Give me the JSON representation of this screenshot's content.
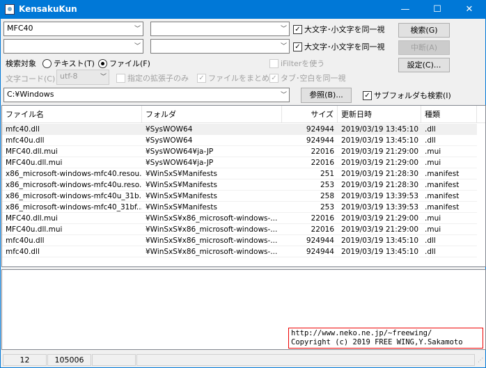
{
  "window": {
    "title": "KensakuKun",
    "minimize": "—",
    "maximize": "☐",
    "close": "✕"
  },
  "search": {
    "pattern1": "MFC40",
    "pattern2": "",
    "pattern3": "",
    "pattern4": "",
    "ignore_case_1": "大文字･小文字を同一視",
    "ignore_case_1_checked": true,
    "ignore_case_2": "大文字･小文字を同一視",
    "ignore_case_2_checked": true,
    "search_button": "検索(G)",
    "abort_button": "中断(A)",
    "settings_button": "設定(C)...",
    "target_label": "検索対象",
    "radio_text": "テキスト(T)",
    "radio_file": "ファイル(F)",
    "selected_target": "file",
    "ifilter": "iFilterを使う",
    "encoding_label": "文字コード(C)",
    "encoding_value": "utf-8",
    "ext_only": "指定の拡張子のみ",
    "group_files": "ファイルをまとめる",
    "tab_space": "タブ･空白を同一視",
    "path": "C:¥Windows",
    "browse_button": "参照(B)...",
    "subfolders": "サブフォルダも検索(I)",
    "subfolders_checked": true
  },
  "results": {
    "columns": [
      "ファイル名",
      "フォルダ",
      "サイズ",
      "更新日時",
      "種類"
    ],
    "rows": [
      [
        "mfc40.dll",
        "¥SysWOW64",
        "924944",
        "2019/03/19 13:45:10",
        ".dll"
      ],
      [
        "mfc40u.dll",
        "¥SysWOW64",
        "924944",
        "2019/03/19 13:45:10",
        ".dll"
      ],
      [
        "MFC40.dll.mui",
        "¥SysWOW64¥ja-JP",
        "22016",
        "2019/03/19 21:29:00",
        ".mui"
      ],
      [
        "MFC40u.dll.mui",
        "¥SysWOW64¥ja-JP",
        "22016",
        "2019/03/19 21:29:00",
        ".mui"
      ],
      [
        "x86_microsoft-windows-mfc40.resou...",
        "¥WinSxS¥Manifests",
        "251",
        "2019/03/19 21:28:30",
        ".manifest"
      ],
      [
        "x86_microsoft-windows-mfc40u.reso...",
        "¥WinSxS¥Manifests",
        "253",
        "2019/03/19 21:28:30",
        ".manifest"
      ],
      [
        "x86_microsoft-windows-mfc40u_31b...",
        "¥WinSxS¥Manifests",
        "258",
        "2019/03/19 13:39:53",
        ".manifest"
      ],
      [
        "x86_microsoft-windows-mfc40_31bf...",
        "¥WinSxS¥Manifests",
        "253",
        "2019/03/19 13:39:53",
        ".manifest"
      ],
      [
        "MFC40.dll.mui",
        "¥WinSxS¥x86_microsoft-windows-...",
        "22016",
        "2019/03/19 21:29:00",
        ".mui"
      ],
      [
        "MFC40u.dll.mui",
        "¥WinSxS¥x86_microsoft-windows-...",
        "22016",
        "2019/03/19 21:29:00",
        ".mui"
      ],
      [
        "mfc40u.dll",
        "¥WinSxS¥x86_microsoft-windows-...",
        "924944",
        "2019/03/19 13:45:10",
        ".dll"
      ],
      [
        "mfc40.dll",
        "¥WinSxS¥x86_microsoft-windows-...",
        "924944",
        "2019/03/19 13:45:10",
        ".dll"
      ]
    ]
  },
  "credit": {
    "url": "http://www.neko.ne.jp/~freewing/",
    "copyright": "Copyright (c) 2019 FREE WING,Y.Sakamoto"
  },
  "status": {
    "count": "12",
    "total_size": "105006",
    "field3": "",
    "field4": ""
  },
  "colors": {
    "titlebar": "#0078d7",
    "credit_border": "#ee0000"
  }
}
